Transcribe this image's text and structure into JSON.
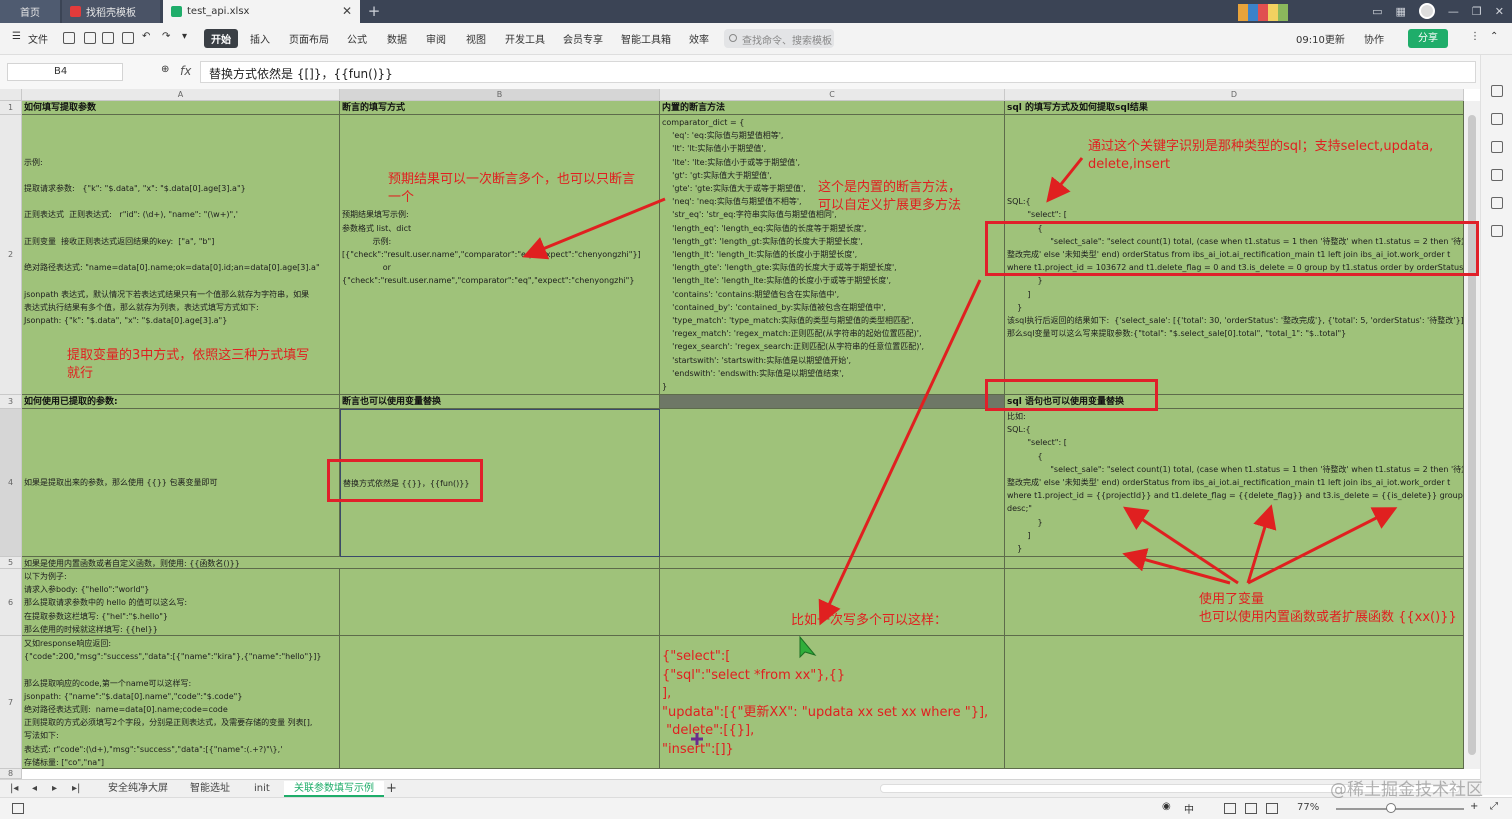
{
  "tabs": [
    {
      "label": "首页"
    },
    {
      "label": "找稻壳模板"
    },
    {
      "label": "test_api.xlsx"
    }
  ],
  "menu": {
    "file": "文件",
    "items": [
      "开始",
      "插入",
      "页面布局",
      "公式",
      "数据",
      "审阅",
      "视图",
      "开发工具",
      "会员专享",
      "智能工具箱",
      "效率"
    ],
    "search": "查找命令、搜索模板",
    "update": "09:10更新",
    "collab": "协作",
    "share": "分享"
  },
  "formula": {
    "namebox": "B4",
    "fx": "fx",
    "content": "替换方式依然是 {[]}，{{fun()}}"
  },
  "columns": [
    "A",
    "B",
    "C",
    "D"
  ],
  "rows": [
    "1",
    "2",
    "3",
    "4",
    "5",
    "6",
    "7",
    "8"
  ],
  "cells": {
    "A1": "如何填写提取参数",
    "B1": "断言的填写方式",
    "C1": "内置的断言方法",
    "D1": "sql 的填写方式及如何提取sql结果",
    "A2": "\n\n\n示例:\n\n提取请求参数:   {\"k\": \"$.data\", \"x\": \"$.data[0].age[3].a\"}\n\n正则表达式  正则表达式:   r\"id\": (\\d+), \"name\": \"(\\w+)\",'\n\n正则变量  接收正则表达式返回结果的key:  [\"a\", \"b\"]\n\n绝对路径表达式: \"name=data[0].name;ok=data[0].id;an=data[0].age[3].a\"\n\njsonpath 表达式，默认情况下若表达式结果只有一个值那么就存为字符串，如果\n表达式执行结果有多个值，那么就存为列表，表达式填写方式如下:\nJsonpath: {\"k\": \"$.data\", \"x\": \"$.data[0].age[3].a\"}",
    "B2": "\n\n\n\n\n\n\n预期结果填写示例:\n参数格式 list、dict\n            示例:\n[{\"check\":\"result.user.name\",\"comparator\":\"eq\",\"expect\":\"chenyongzhi\"}]\n                or\n{\"check\":\"result.user.name\",\"comparator\":\"eq\",\"expect\":\"chenyongzhi\"}",
    "C2": "comparator_dict = {\n    'eq': 'eq:实际值与期望值相等',\n    'lt': 'lt:实际值小于期望值',\n    'lte': 'lte:实际值小于或等于期望值',\n    'gt': 'gt:实际值大于期望值',\n    'gte': 'gte:实际值大于或等于期望值',\n    'neq': 'neq:实际值与期望值不相等',\n    'str_eq': 'str_eq:字符串实际值与期望值相同',\n    'length_eq': 'length_eq:实际值的长度等于期望长度',\n    'length_gt': 'length_gt:实际值的长度大于期望长度',\n    'length_lt': 'length_lt:实际值的长度小于期望长度',\n    'length_gte': 'length_gte:实际值的长度大于或等于期望长度',\n    'length_lte': 'length_lte:实际值的长度小于或等于期望长度',\n    'contains': 'contains:期望值包含在实际值中',\n    'contained_by': 'contained_by:实际值被包含在期望值中',\n    'type_match': 'type_match:实际值的类型与期望值的类型相匹配',\n    'regex_match': 'regex_match:正则匹配(从字符串的起始位置匹配)',\n    'regex_search': 'regex_search:正则匹配(从字符串的任意位置匹配)',\n    'startswith': 'startswith:实际值是以期望值开始',\n    'endswith': 'endswith:实际值是以期望值结束',\n}",
    "D2": "\n\n\n\n\n\nSQL:{\n        \"select\": [\n            {\n                 \"select_sale\": \"select count(1) total, (case when t1.status = 1 then '待整改' when t1.status = 2 then '待复\n整改完成' else '未知类型' end) orderStatus from ibs_ai_iot.ai_rectification_main t1 left join ibs_ai_iot.work_order t\nwhere t1.project_id = 103672 and t1.delete_flag = 0 and t3.is_delete = 0 group by t1.status order by orderStatus\n            }\n        ]\n    }\n该sql执行后返回的结果如下:  {'select_sale': [{'total': 30, 'orderStatus': '整改完成'}, {'total': 5, 'orderStatus': '待整改'}]}\n那么sql变量可以这么写来提取参数:{\"total\": \"$.select_sale[0].total\", \"total_1\": \"$..total\"}",
    "A3": "如何使用已提取的参数:",
    "B3": "断言也可以使用变量替换",
    "C3": "",
    "D3": "sql 语句也可以使用变量替换",
    "A4": "\n\n\n\n\n如果是提取出来的参数，那么使用 {{}} 包裹变量即可",
    "B4": "\n\n\n\n\n替换方式依然是 {{}}，{{fun()}}",
    "C4": "",
    "D4": "比如:\nSQL:{\n        \"select\": [\n            {\n                 \"select_sale\": \"select count(1) total, (case when t1.status = 1 then '待整改' when t1.status = 2 then '待复\n整改完成' else '未知类型' end) orderStatus from ibs_ai_iot.ai_rectification_main t1 left join ibs_ai_iot.work_order t\nwhere t1.project_id = {{projectId}} and t1.delete_flag = {{delete_flag}} and t3.is_delete = {{is_delete}} group by t1\ndesc;\"\n            }\n        ]\n    }",
    "A5": "如果是使用内置函数或者自定义函数，则使用: {{函数名()}}",
    "A6": "以下为例子:\n请求入参body: {\"hello\":\"world\"}\n那么提取请求参数中的 hello 的值可以这么写:\n在提取参数这栏填写: {\"hel\":\"$.hello\"}\n那么使用的时候就这样填写: {{hel}}",
    "A7": "又如response响应返回:\n{\"code\":200,\"msg\":\"success\",\"data\":[{\"name\":\"kira\"},{\"name\":\"hello\"}]}\n\n那么提取响应的code,第一个name可以这样写:\njsonpath: {\"name\":\"$.data[0].name\",\"code\":\"$.code\"}\n绝对路径表达式则:  name=data[0].name;code=code\n正则提取的方式必须填写2个字段，分别是正则表达式，及需要存储的变量 列表[],\n写法如下:\n表达式: r\"code\":(\\d+),\"msg\":\"success\",\"data\":[{\"name\":(.+?)\"\\},'\n存储标量: [\"co\",\"na\"]",
    "C7": "{\"select\":[\n{\"sql\":\"select *from xx\"},{}\n],\n\"updata\":[{\"更新XX\": \"updata xx set xx where \"}],\n \"delete\":[{}],\n\"insert\":[]}"
  },
  "annotations": {
    "a1": "预期结果可以一次断言多个，也可以只断言\n一个",
    "a2": "这个是内置的断言方法，\n可以自定义扩展更多方法",
    "a3": "通过这个关键字识别是那种类型的sql；支持select,updata,\ndelete,insert",
    "a4": "提取变量的3中方式，依照这三种方式填写\n就行",
    "a5": "比如一次写多个可以这样：",
    "a6": "使用了变量\n也可以使用内置函数或者扩展函数 {{xx()}}"
  },
  "sheets": [
    "安全纯净大屏",
    "智能选址",
    "init",
    "关联参数填写示例"
  ],
  "status": {
    "zoom": "77%"
  },
  "watermark": "@稀土掘金技术社区"
}
